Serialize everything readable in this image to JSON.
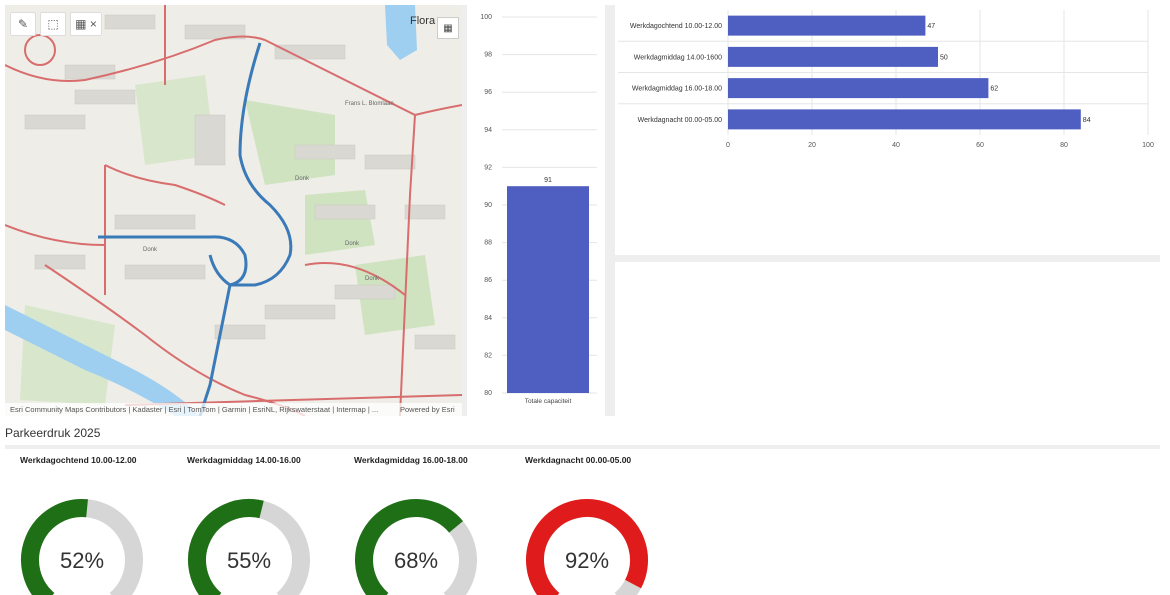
{
  "map": {
    "flora_label": "Flora",
    "attribution": "Esri Community Maps Contributors | Kadaster | Esri | TomTom | Garmin | EsriNL, Rijkswaterstaat | Intermap | ...",
    "powered_by": "Powered by Esri",
    "street_labels": [
      "Donk",
      "Donk",
      "Donk",
      "Donk",
      "Frans L. Blomlaan"
    ],
    "tools": [
      "draw-icon",
      "select-icon",
      "table-icon",
      "close-icon"
    ]
  },
  "chart_data": [
    {
      "type": "bar",
      "orientation": "vertical",
      "categories": [
        "Totale capaciteit"
      ],
      "values": [
        91
      ],
      "ylim": [
        80,
        100
      ],
      "yticks": [
        80,
        82,
        84,
        86,
        88,
        90,
        92,
        94,
        96,
        98,
        100
      ],
      "color": "#4f5fc1"
    },
    {
      "type": "bar",
      "orientation": "horizontal",
      "categories": [
        "Werkdagochtend 10.00-12.00",
        "Werkdagmiddag 14.00-1600",
        "Werkdagmiddag 16.00-18.00",
        "Werkdagnacht 00.00-05.00"
      ],
      "values": [
        47,
        50,
        62,
        84
      ],
      "xlim": [
        0,
        100
      ],
      "xticks": [
        0,
        20,
        40,
        60,
        80,
        100
      ],
      "color": "#4f5fc1"
    }
  ],
  "section_title": "Parkeerdruk 2025",
  "gauges": [
    {
      "title": "Werkdagochtend 10.00-12.00",
      "value": 52,
      "label": "52%",
      "color": "#1f6f16"
    },
    {
      "title": "Werkdagmiddag 14.00-16.00",
      "value": 55,
      "label": "55%",
      "color": "#1f6f16"
    },
    {
      "title": "Werkdagmiddag 16.00-18.00",
      "value": 68,
      "label": "68%",
      "color": "#1f6f16"
    },
    {
      "title": "Werkdagnacht 00.00-05.00",
      "value": 92,
      "label": "92%",
      "color": "#e01b1b"
    }
  ]
}
